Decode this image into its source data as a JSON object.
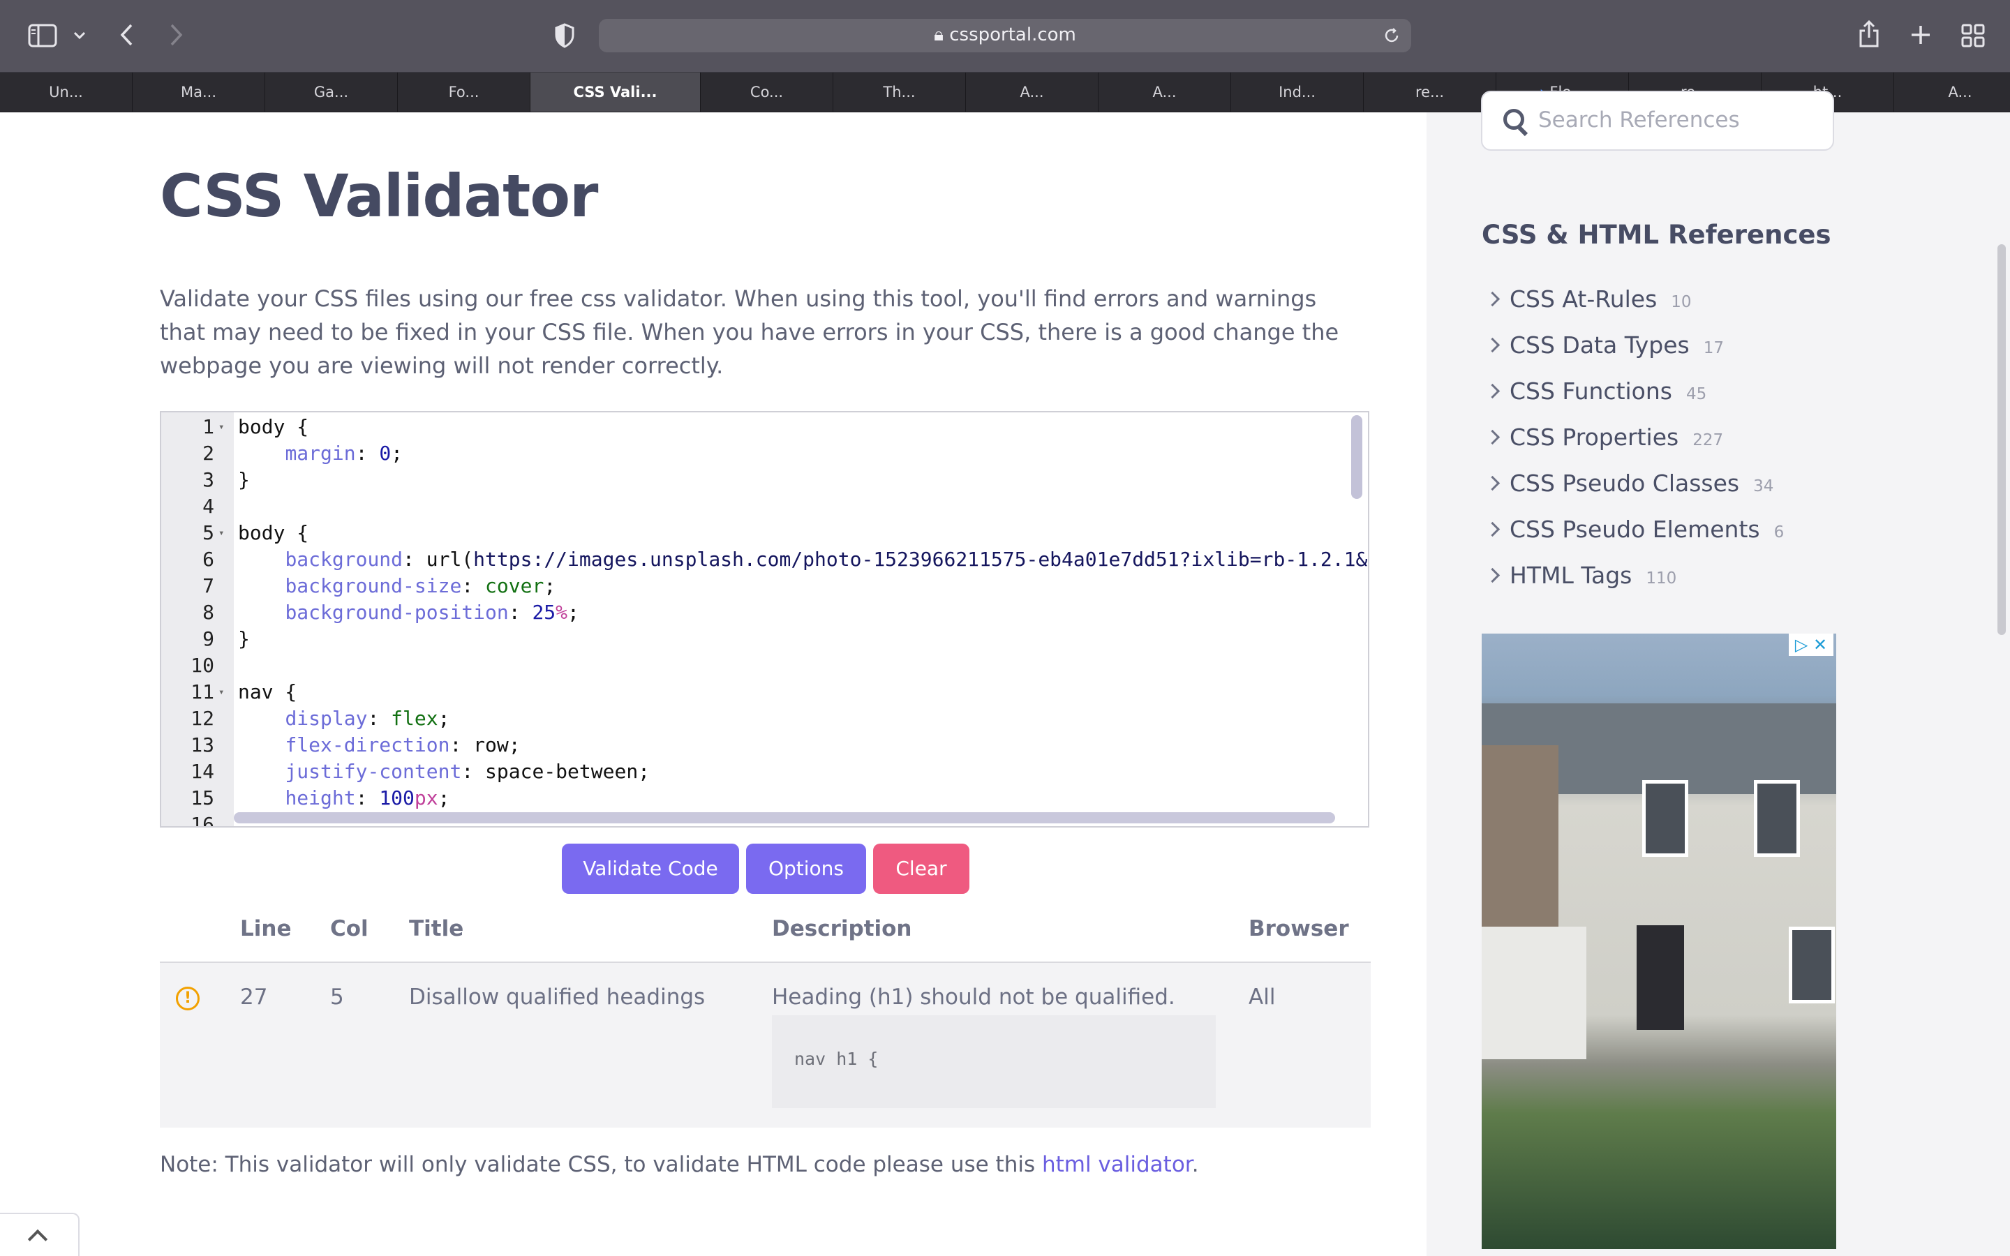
{
  "browser": {
    "url": "cssportal.com",
    "tabs": [
      {
        "label": "Un...",
        "active": false
      },
      {
        "label": "Ma...",
        "active": false
      },
      {
        "label": "Ga...",
        "active": false
      },
      {
        "label": "Fo...",
        "active": false
      },
      {
        "label": "CSS Vali...",
        "active": true
      },
      {
        "label": "Co...",
        "active": false
      },
      {
        "label": "Th...",
        "active": false
      },
      {
        "label": "A...",
        "active": false
      },
      {
        "label": "A...",
        "active": false
      },
      {
        "label": "Ind...",
        "active": false
      },
      {
        "label": "re...",
        "active": false
      },
      {
        "label": "Fle...",
        "active": false,
        "icon": "chevron-right-icon"
      },
      {
        "label": "re...",
        "active": false
      },
      {
        "label": "ht...",
        "active": false
      },
      {
        "label": "A...",
        "active": false
      }
    ],
    "toolbar_icons": [
      "sidebar-icon",
      "chevron-down-icon",
      "back-icon",
      "forward-icon",
      "privacy-shield-icon",
      "lock-icon",
      "reload-icon",
      "share-icon",
      "new-tab-icon",
      "tab-overview-icon"
    ]
  },
  "page": {
    "title": "CSS Validator",
    "intro": "Validate your CSS files using our free css validator. When using this tool, you'll find errors and warnings that may need to be fixed in your CSS file. When you have errors in your CSS, there is a good change the webpage you are viewing will not render correctly."
  },
  "editor": {
    "lines": [
      {
        "n": "1",
        "fold": true,
        "text": "body {"
      },
      {
        "n": "2",
        "fold": false,
        "text": "    margin: 0;"
      },
      {
        "n": "3",
        "fold": false,
        "text": "}"
      },
      {
        "n": "4",
        "fold": false,
        "text": ""
      },
      {
        "n": "5",
        "fold": true,
        "text": "body {"
      },
      {
        "n": "6",
        "fold": false,
        "text": "    background: url(https://images.unsplash.com/photo-1523966211575-eb4a01e7dd51?ixlib=rb-1.2.1&"
      },
      {
        "n": "7",
        "fold": false,
        "text": "    background-size: cover;"
      },
      {
        "n": "8",
        "fold": false,
        "text": "    background-position: 25%;"
      },
      {
        "n": "9",
        "fold": false,
        "text": "}"
      },
      {
        "n": "10",
        "fold": false,
        "text": ""
      },
      {
        "n": "11",
        "fold": true,
        "text": "nav {"
      },
      {
        "n": "12",
        "fold": false,
        "text": "    display: flex;"
      },
      {
        "n": "13",
        "fold": false,
        "text": "    flex-direction: row;"
      },
      {
        "n": "14",
        "fold": false,
        "text": "    justify-content: space-between;"
      },
      {
        "n": "15",
        "fold": false,
        "text": "    height: 100px;"
      },
      {
        "n": "16",
        "fold": false,
        "text": ""
      }
    ]
  },
  "actions": {
    "validate": "Validate Code",
    "options": "Options",
    "clear": "Clear"
  },
  "results": {
    "headers": {
      "line": "Line",
      "col": "Col",
      "title": "Title",
      "description": "Description",
      "browser": "Browser"
    },
    "rows": [
      {
        "severity_icon": "warning-icon",
        "line": "27",
        "col": "5",
        "title": "Disallow qualified headings",
        "description": "Heading (h1) should not be qualified.",
        "snippet": "nav h1 {",
        "browser": "All"
      }
    ]
  },
  "note": {
    "text": "Note: This validator will only validate CSS, to validate HTML code please use this ",
    "link": "html validator",
    "suffix": "."
  },
  "sidebar": {
    "search_placeholder": "Search References",
    "title": "CSS & HTML References",
    "items": [
      {
        "label": "CSS At-Rules",
        "count": "10"
      },
      {
        "label": "CSS Data Types",
        "count": "17"
      },
      {
        "label": "CSS Functions",
        "count": "45"
      },
      {
        "label": "CSS Properties",
        "count": "227"
      },
      {
        "label": "CSS Pseudo Classes",
        "count": "34"
      },
      {
        "label": "CSS Pseudo Elements",
        "count": "6"
      },
      {
        "label": "HTML Tags",
        "count": "110"
      }
    ],
    "ad_icons": [
      "adchoices-icon",
      "close-icon"
    ]
  },
  "colors": {
    "accent": "#7a6af0",
    "danger": "#ef5a80",
    "warning": "#f2a100",
    "heading": "#454a62"
  }
}
